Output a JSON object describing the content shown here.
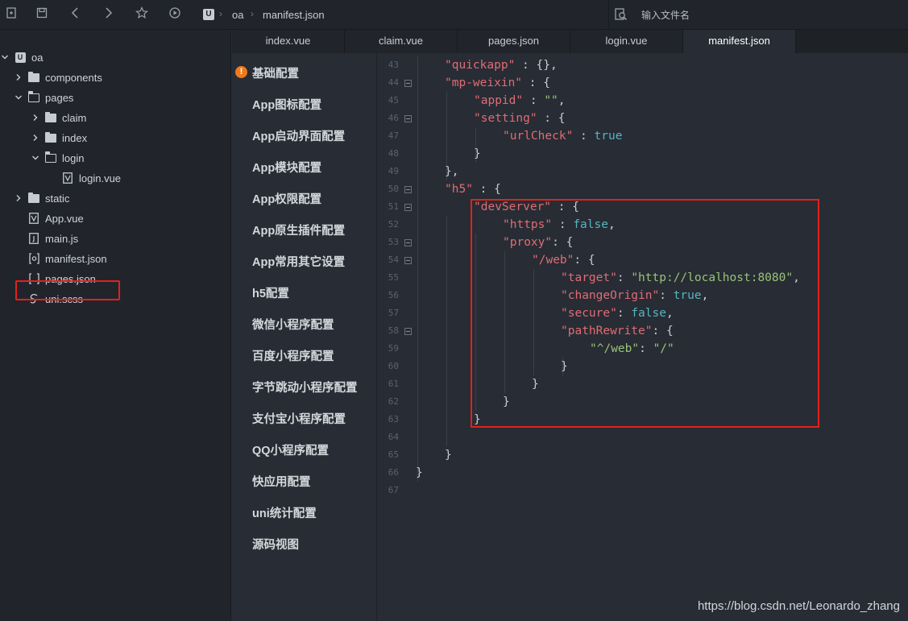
{
  "toolbar": {
    "icons": [
      "new-file-icon",
      "save-icon",
      "back-icon",
      "forward-icon",
      "star-icon",
      "run-icon"
    ],
    "breadcrumb": {
      "logo": "U",
      "project": "oa",
      "file": "manifest.json"
    },
    "file_search": {
      "placeholder": "输入文件名"
    }
  },
  "sidebar": {
    "root": "oa",
    "items": [
      {
        "label": "components",
        "type": "folder",
        "expanded": false
      },
      {
        "label": "pages",
        "type": "folder",
        "expanded": true
      },
      {
        "label": "claim",
        "type": "folder",
        "expanded": false
      },
      {
        "label": "index",
        "type": "folder",
        "expanded": false
      },
      {
        "label": "login",
        "type": "folder",
        "expanded": true
      },
      {
        "label": "login.vue",
        "type": "vue-file"
      },
      {
        "label": "static",
        "type": "folder",
        "expanded": false
      },
      {
        "label": "App.vue",
        "type": "vue-file"
      },
      {
        "label": "main.js",
        "type": "js-file"
      },
      {
        "label": "manifest.json",
        "type": "manifest-file",
        "highlighted": true
      },
      {
        "label": "pages.json",
        "type": "json-file"
      },
      {
        "label": "uni.scss",
        "type": "scss-file"
      }
    ]
  },
  "tabs": [
    {
      "label": "index.vue",
      "active": false
    },
    {
      "label": "claim.vue",
      "active": false
    },
    {
      "label": "pages.json",
      "active": false
    },
    {
      "label": "login.vue",
      "active": false
    },
    {
      "label": "manifest.json",
      "active": true
    }
  ],
  "config_nav": [
    {
      "label": "基础配置",
      "warning": true
    },
    {
      "label": "App图标配置"
    },
    {
      "label": "App启动界面配置"
    },
    {
      "label": "App模块配置"
    },
    {
      "label": "App权限配置"
    },
    {
      "label": "App原生插件配置"
    },
    {
      "label": "App常用其它设置"
    },
    {
      "label": "h5配置"
    },
    {
      "label": "微信小程序配置"
    },
    {
      "label": "百度小程序配置"
    },
    {
      "label": "字节跳动小程序配置"
    },
    {
      "label": "支付宝小程序配置"
    },
    {
      "label": "QQ小程序配置"
    },
    {
      "label": "快应用配置"
    },
    {
      "label": "uni统计配置"
    },
    {
      "label": "源码视图"
    }
  ],
  "editor": {
    "lines": [
      {
        "num": "43",
        "tokens": [
          [
            "k",
            "\"quickapp\""
          ],
          [
            "p",
            " : {},"
          ]
        ]
      },
      {
        "num": "44",
        "fold": true,
        "tokens": [
          [
            "k",
            "\"mp-weixin\""
          ],
          [
            "p",
            " : {"
          ]
        ]
      },
      {
        "num": "45",
        "tokens": [
          [
            "k",
            "\"appid\""
          ],
          [
            "p",
            " : "
          ],
          [
            "s",
            "\"\""
          ],
          [
            "p",
            ","
          ]
        ]
      },
      {
        "num": "46",
        "fold": true,
        "tokens": [
          [
            "k",
            "\"setting\""
          ],
          [
            "p",
            " : {"
          ]
        ]
      },
      {
        "num": "47",
        "tokens": [
          [
            "k",
            "\"urlCheck\""
          ],
          [
            "p",
            " : "
          ],
          [
            "b",
            "true"
          ]
        ]
      },
      {
        "num": "48",
        "tokens": [
          [
            "p",
            "}"
          ]
        ]
      },
      {
        "num": "49",
        "tokens": [
          [
            "p",
            "},"
          ]
        ]
      },
      {
        "num": "50",
        "fold": true,
        "tokens": [
          [
            "k",
            "\"h5\""
          ],
          [
            "p",
            " : {"
          ]
        ]
      },
      {
        "num": "51",
        "fold": true,
        "tokens": [
          [
            "k",
            "\"devServer\""
          ],
          [
            "p",
            " : {"
          ]
        ]
      },
      {
        "num": "52",
        "tokens": [
          [
            "k",
            "\"https\""
          ],
          [
            "p",
            " : "
          ],
          [
            "b",
            "false"
          ],
          [
            "p",
            ","
          ]
        ]
      },
      {
        "num": "53",
        "fold": true,
        "tokens": [
          [
            "k",
            "\"proxy\""
          ],
          [
            "p",
            ": {"
          ]
        ]
      },
      {
        "num": "54",
        "fold": true,
        "tokens": [
          [
            "k",
            "\"/web\""
          ],
          [
            "p",
            ": {"
          ]
        ]
      },
      {
        "num": "55",
        "tokens": [
          [
            "k",
            "\"target\""
          ],
          [
            "p",
            ": "
          ],
          [
            "s",
            "\"http://localhost:8080\""
          ],
          [
            "p",
            ","
          ]
        ]
      },
      {
        "num": "56",
        "tokens": [
          [
            "k",
            "\"changeOrigin\""
          ],
          [
            "p",
            ": "
          ],
          [
            "b",
            "true"
          ],
          [
            "p",
            ","
          ]
        ]
      },
      {
        "num": "57",
        "tokens": [
          [
            "k",
            "\"secure\""
          ],
          [
            "p",
            ": "
          ],
          [
            "b",
            "false"
          ],
          [
            "p",
            ","
          ]
        ]
      },
      {
        "num": "58",
        "fold": true,
        "tokens": [
          [
            "k",
            "\"pathRewrite\""
          ],
          [
            "p",
            ": {"
          ]
        ]
      },
      {
        "num": "59",
        "tokens": [
          [
            "s",
            "\"^/web\""
          ],
          [
            "p",
            ": "
          ],
          [
            "s",
            "\"/\""
          ]
        ]
      },
      {
        "num": "60",
        "tokens": [
          [
            "p",
            "}"
          ]
        ]
      },
      {
        "num": "61",
        "tokens": [
          [
            "p",
            "}"
          ]
        ]
      },
      {
        "num": "62",
        "tokens": [
          [
            "p",
            "}"
          ]
        ]
      },
      {
        "num": "63",
        "tokens": [
          [
            "p",
            "}"
          ]
        ]
      },
      {
        "num": "64",
        "tokens": []
      },
      {
        "num": "65",
        "tokens": [
          [
            "p",
            "}"
          ]
        ]
      },
      {
        "num": "66",
        "tokens": [
          [
            "p",
            "}"
          ]
        ]
      },
      {
        "num": "67",
        "tokens": []
      }
    ]
  },
  "watermark": "https://blog.csdn.net/Leonardo_zhang",
  "colors": {
    "key": "#e06c75",
    "string": "#98c379",
    "boolean": "#56b6c2",
    "highlight": "#e2211c",
    "warning": "#f07a1a"
  }
}
